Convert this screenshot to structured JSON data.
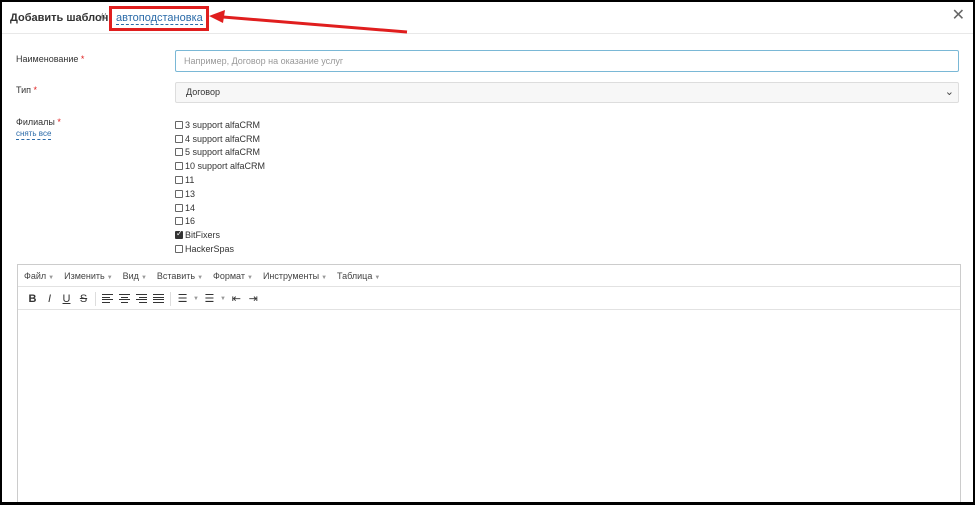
{
  "header": {
    "title": "Добавить шаблон",
    "separator": "//",
    "autolink": "автоподстановка"
  },
  "form": {
    "name_label": "Наименование",
    "name_placeholder": "Например, Договор на оказание услуг",
    "type_label": "Тип",
    "type_value": "Договор",
    "branches_label": "Филиалы",
    "clear_all": "снять все",
    "required_mark": "*"
  },
  "branches": [
    {
      "label": "3 support alfaCRM",
      "checked": false
    },
    {
      "label": "4 support alfaCRM",
      "checked": false
    },
    {
      "label": "5 support alfaCRM",
      "checked": false
    },
    {
      "label": "10 support alfaCRM",
      "checked": false
    },
    {
      "label": "11",
      "checked": false
    },
    {
      "label": "13",
      "checked": false
    },
    {
      "label": "14",
      "checked": false
    },
    {
      "label": "16",
      "checked": false
    },
    {
      "label": "BitFixers",
      "checked": true
    },
    {
      "label": "HackerSpas",
      "checked": false
    }
  ],
  "editor": {
    "menu": [
      "Файл",
      "Изменить",
      "Вид",
      "Вставить",
      "Формат",
      "Инструменты",
      "Таблица"
    ],
    "bold": "B",
    "italic": "I",
    "underline": "U",
    "strike": "S"
  },
  "colors": {
    "highlight": "#e01e1e",
    "link": "#2a6aa8",
    "input_focus_border": "#7ab8d6"
  }
}
